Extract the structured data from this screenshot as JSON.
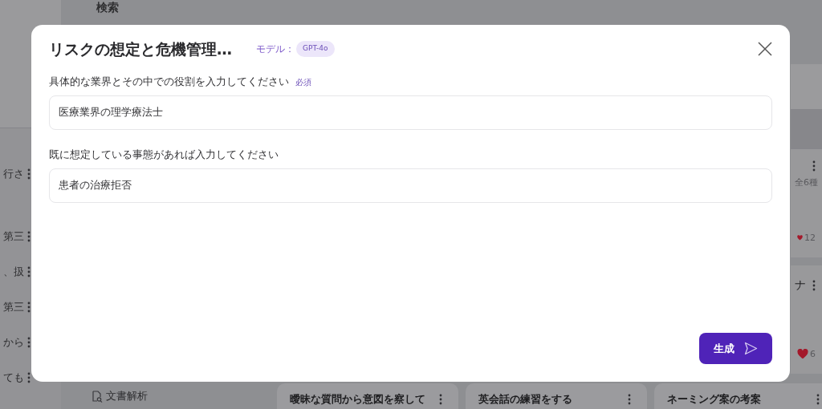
{
  "background": {
    "search_heading": "検索",
    "sidebar_items": [
      {
        "text": "行さ"
      },
      {
        "text": "第三"
      },
      {
        "text": "、扱"
      },
      {
        "text": "第三"
      },
      {
        "text": "から"
      },
      {
        "text": "ても"
      }
    ],
    "side_cards": [
      {
        "note": "全6種",
        "likes": "12"
      },
      {
        "title": "ナ",
        "likes": "6"
      }
    ],
    "nav_item": "文書解析",
    "cards": [
      {
        "title": "曖昧な質問から意図を察して"
      },
      {
        "title": "英会話の練習をする"
      },
      {
        "title": "ネーミング案の考案"
      }
    ]
  },
  "dialog": {
    "title": "リスクの想定と危機管理…",
    "model_label": "モデル：",
    "model": "GPT-4o",
    "fields": [
      {
        "label": "具体的な業界とその中での役割を入力してください",
        "required_label": "必須",
        "value": "医療業界の理学療法士"
      },
      {
        "label": "既に想定している事態があれば入力してください",
        "value": "患者の治療拒否"
      }
    ],
    "submit": "生成"
  }
}
